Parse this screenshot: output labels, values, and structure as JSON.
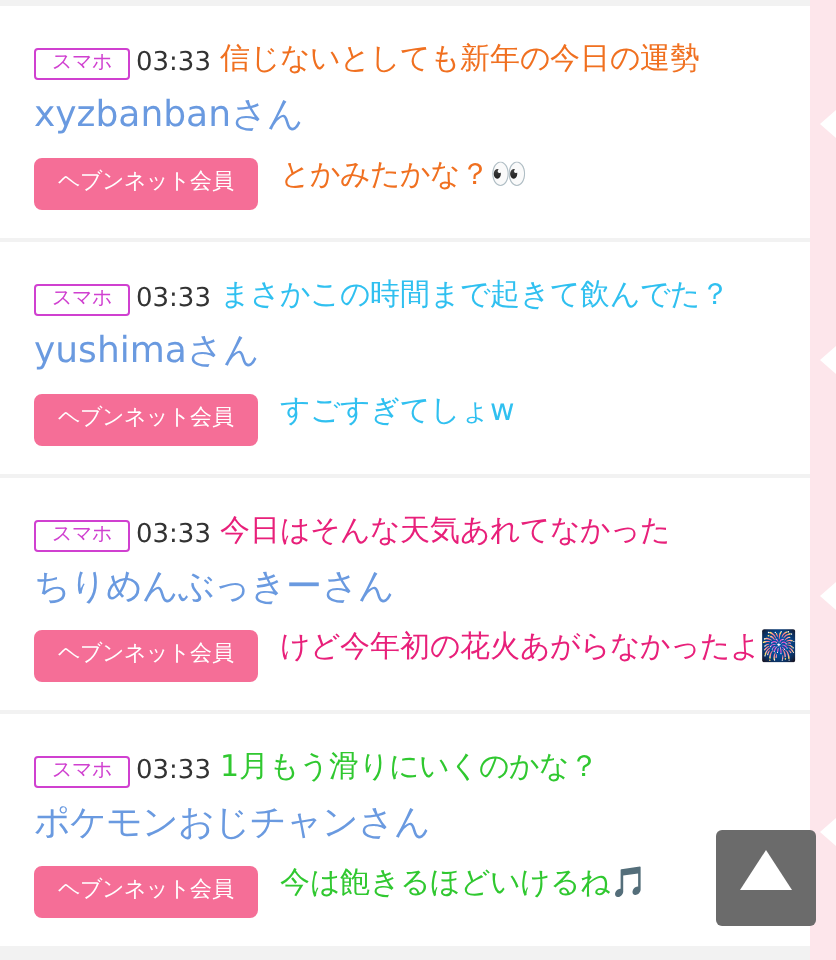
{
  "posts": [
    {
      "device": "スマホ",
      "time": "03:33",
      "name": "xyzbanbanさん",
      "member_button": "ヘブンネット会員",
      "caption": {
        "color": "#f07020",
        "lines": [
          "信じないとしても新年の今日の運勢",
          "とかみたかな？👀"
        ]
      }
    },
    {
      "device": "スマホ",
      "time": "03:33",
      "name": "yushimaさん",
      "member_button": "ヘブンネット会員",
      "caption": {
        "color": "#30c0f0",
        "lines": [
          "まさかこの時間まで起きて飲んでた？",
          "すごすぎてしょw"
        ]
      }
    },
    {
      "device": "スマホ",
      "time": "03:33",
      "name": "ちりめんぶっきーさん",
      "member_button": "ヘブンネット会員",
      "caption": {
        "color": "#e8207a",
        "lines": [
          "今日はそんな天気あれてなかった",
          "けど今年初の花火あがらなかったよ🎆"
        ]
      }
    },
    {
      "device": "スマホ",
      "time": "03:33",
      "name": "ポケモンおじチャンさん",
      "member_button": "ヘブンネット会員",
      "caption": {
        "color": "#30c830",
        "lines": [
          "1月もう滑りにいくのかな？",
          "今は飽きるほどいけるね🎵"
        ]
      }
    }
  ]
}
